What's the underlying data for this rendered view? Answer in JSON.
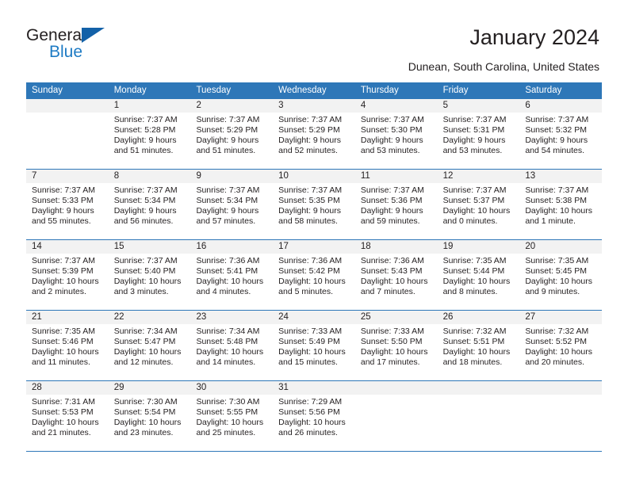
{
  "brand": {
    "name_part1": "General",
    "name_part2": "Blue",
    "accent_color": "#1e7bc4",
    "triangle_color": "#1361a8"
  },
  "header": {
    "title": "January 2024",
    "subtitle": "Dunean, South Carolina, United States",
    "header_bg": "#2e77b8",
    "header_text_color": "#ffffff"
  },
  "calendar": {
    "weekday_headers": [
      "Sunday",
      "Monday",
      "Tuesday",
      "Wednesday",
      "Thursday",
      "Friday",
      "Saturday"
    ],
    "weeks": [
      [
        {
          "day": "",
          "sunrise": "",
          "sunset": "",
          "daylight1": "",
          "daylight2": ""
        },
        {
          "day": "1",
          "sunrise": "Sunrise: 7:37 AM",
          "sunset": "Sunset: 5:28 PM",
          "daylight1": "Daylight: 9 hours",
          "daylight2": "and 51 minutes."
        },
        {
          "day": "2",
          "sunrise": "Sunrise: 7:37 AM",
          "sunset": "Sunset: 5:29 PM",
          "daylight1": "Daylight: 9 hours",
          "daylight2": "and 51 minutes."
        },
        {
          "day": "3",
          "sunrise": "Sunrise: 7:37 AM",
          "sunset": "Sunset: 5:29 PM",
          "daylight1": "Daylight: 9 hours",
          "daylight2": "and 52 minutes."
        },
        {
          "day": "4",
          "sunrise": "Sunrise: 7:37 AM",
          "sunset": "Sunset: 5:30 PM",
          "daylight1": "Daylight: 9 hours",
          "daylight2": "and 53 minutes."
        },
        {
          "day": "5",
          "sunrise": "Sunrise: 7:37 AM",
          "sunset": "Sunset: 5:31 PM",
          "daylight1": "Daylight: 9 hours",
          "daylight2": "and 53 minutes."
        },
        {
          "day": "6",
          "sunrise": "Sunrise: 7:37 AM",
          "sunset": "Sunset: 5:32 PM",
          "daylight1": "Daylight: 9 hours",
          "daylight2": "and 54 minutes."
        }
      ],
      [
        {
          "day": "7",
          "sunrise": "Sunrise: 7:37 AM",
          "sunset": "Sunset: 5:33 PM",
          "daylight1": "Daylight: 9 hours",
          "daylight2": "and 55 minutes."
        },
        {
          "day": "8",
          "sunrise": "Sunrise: 7:37 AM",
          "sunset": "Sunset: 5:34 PM",
          "daylight1": "Daylight: 9 hours",
          "daylight2": "and 56 minutes."
        },
        {
          "day": "9",
          "sunrise": "Sunrise: 7:37 AM",
          "sunset": "Sunset: 5:34 PM",
          "daylight1": "Daylight: 9 hours",
          "daylight2": "and 57 minutes."
        },
        {
          "day": "10",
          "sunrise": "Sunrise: 7:37 AM",
          "sunset": "Sunset: 5:35 PM",
          "daylight1": "Daylight: 9 hours",
          "daylight2": "and 58 minutes."
        },
        {
          "day": "11",
          "sunrise": "Sunrise: 7:37 AM",
          "sunset": "Sunset: 5:36 PM",
          "daylight1": "Daylight: 9 hours",
          "daylight2": "and 59 minutes."
        },
        {
          "day": "12",
          "sunrise": "Sunrise: 7:37 AM",
          "sunset": "Sunset: 5:37 PM",
          "daylight1": "Daylight: 10 hours",
          "daylight2": "and 0 minutes."
        },
        {
          "day": "13",
          "sunrise": "Sunrise: 7:37 AM",
          "sunset": "Sunset: 5:38 PM",
          "daylight1": "Daylight: 10 hours",
          "daylight2": "and 1 minute."
        }
      ],
      [
        {
          "day": "14",
          "sunrise": "Sunrise: 7:37 AM",
          "sunset": "Sunset: 5:39 PM",
          "daylight1": "Daylight: 10 hours",
          "daylight2": "and 2 minutes."
        },
        {
          "day": "15",
          "sunrise": "Sunrise: 7:37 AM",
          "sunset": "Sunset: 5:40 PM",
          "daylight1": "Daylight: 10 hours",
          "daylight2": "and 3 minutes."
        },
        {
          "day": "16",
          "sunrise": "Sunrise: 7:36 AM",
          "sunset": "Sunset: 5:41 PM",
          "daylight1": "Daylight: 10 hours",
          "daylight2": "and 4 minutes."
        },
        {
          "day": "17",
          "sunrise": "Sunrise: 7:36 AM",
          "sunset": "Sunset: 5:42 PM",
          "daylight1": "Daylight: 10 hours",
          "daylight2": "and 5 minutes."
        },
        {
          "day": "18",
          "sunrise": "Sunrise: 7:36 AM",
          "sunset": "Sunset: 5:43 PM",
          "daylight1": "Daylight: 10 hours",
          "daylight2": "and 7 minutes."
        },
        {
          "day": "19",
          "sunrise": "Sunrise: 7:35 AM",
          "sunset": "Sunset: 5:44 PM",
          "daylight1": "Daylight: 10 hours",
          "daylight2": "and 8 minutes."
        },
        {
          "day": "20",
          "sunrise": "Sunrise: 7:35 AM",
          "sunset": "Sunset: 5:45 PM",
          "daylight1": "Daylight: 10 hours",
          "daylight2": "and 9 minutes."
        }
      ],
      [
        {
          "day": "21",
          "sunrise": "Sunrise: 7:35 AM",
          "sunset": "Sunset: 5:46 PM",
          "daylight1": "Daylight: 10 hours",
          "daylight2": "and 11 minutes."
        },
        {
          "day": "22",
          "sunrise": "Sunrise: 7:34 AM",
          "sunset": "Sunset: 5:47 PM",
          "daylight1": "Daylight: 10 hours",
          "daylight2": "and 12 minutes."
        },
        {
          "day": "23",
          "sunrise": "Sunrise: 7:34 AM",
          "sunset": "Sunset: 5:48 PM",
          "daylight1": "Daylight: 10 hours",
          "daylight2": "and 14 minutes."
        },
        {
          "day": "24",
          "sunrise": "Sunrise: 7:33 AM",
          "sunset": "Sunset: 5:49 PM",
          "daylight1": "Daylight: 10 hours",
          "daylight2": "and 15 minutes."
        },
        {
          "day": "25",
          "sunrise": "Sunrise: 7:33 AM",
          "sunset": "Sunset: 5:50 PM",
          "daylight1": "Daylight: 10 hours",
          "daylight2": "and 17 minutes."
        },
        {
          "day": "26",
          "sunrise": "Sunrise: 7:32 AM",
          "sunset": "Sunset: 5:51 PM",
          "daylight1": "Daylight: 10 hours",
          "daylight2": "and 18 minutes."
        },
        {
          "day": "27",
          "sunrise": "Sunrise: 7:32 AM",
          "sunset": "Sunset: 5:52 PM",
          "daylight1": "Daylight: 10 hours",
          "daylight2": "and 20 minutes."
        }
      ],
      [
        {
          "day": "28",
          "sunrise": "Sunrise: 7:31 AM",
          "sunset": "Sunset: 5:53 PM",
          "daylight1": "Daylight: 10 hours",
          "daylight2": "and 21 minutes."
        },
        {
          "day": "29",
          "sunrise": "Sunrise: 7:30 AM",
          "sunset": "Sunset: 5:54 PM",
          "daylight1": "Daylight: 10 hours",
          "daylight2": "and 23 minutes."
        },
        {
          "day": "30",
          "sunrise": "Sunrise: 7:30 AM",
          "sunset": "Sunset: 5:55 PM",
          "daylight1": "Daylight: 10 hours",
          "daylight2": "and 25 minutes."
        },
        {
          "day": "31",
          "sunrise": "Sunrise: 7:29 AM",
          "sunset": "Sunset: 5:56 PM",
          "daylight1": "Daylight: 10 hours",
          "daylight2": "and 26 minutes."
        },
        {
          "day": "",
          "sunrise": "",
          "sunset": "",
          "daylight1": "",
          "daylight2": ""
        },
        {
          "day": "",
          "sunrise": "",
          "sunset": "",
          "daylight1": "",
          "daylight2": ""
        },
        {
          "day": "",
          "sunrise": "",
          "sunset": "",
          "daylight1": "",
          "daylight2": ""
        }
      ]
    ]
  }
}
